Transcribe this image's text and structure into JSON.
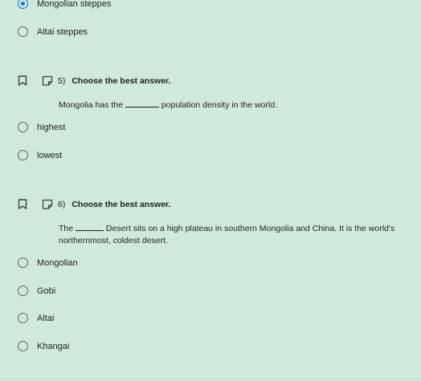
{
  "q4": {
    "options": [
      {
        "label": "Mongolian steppes",
        "selected": true
      },
      {
        "label": "Altai steppes",
        "selected": false
      }
    ]
  },
  "q5": {
    "number": "5)",
    "instruction": "Choose the best answer.",
    "text_before": "Mongolia has the ",
    "text_after": " population density in the world.",
    "options": [
      {
        "label": "highest"
      },
      {
        "label": "lowest"
      }
    ]
  },
  "q6": {
    "number": "6)",
    "instruction": "Choose the best answer.",
    "text_before": "The ",
    "text_after": " Desert sits on a high plateau in southern Mongolia and China. It is the world's northernmost, coldest desert.",
    "options": [
      {
        "label": "Mongolian"
      },
      {
        "label": "Gobi"
      },
      {
        "label": "Altai"
      },
      {
        "label": "Khangai"
      }
    ]
  },
  "colors": {
    "background": "#cfeada",
    "accent": "#1a73e8"
  }
}
